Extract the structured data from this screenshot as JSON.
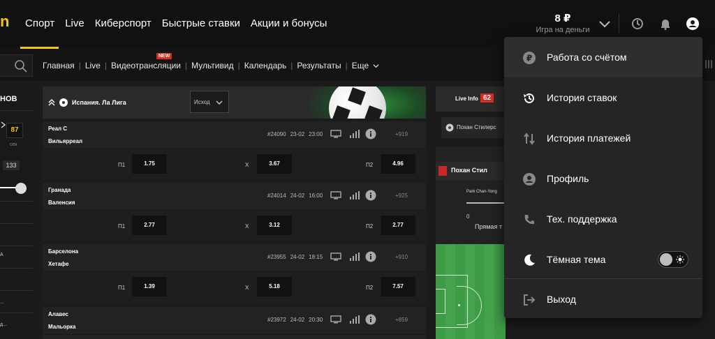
{
  "header": {
    "nav": [
      "Спорт",
      "Live",
      "Киберспорт",
      "Быстрые ставки",
      "Акции и бонусы"
    ],
    "balance_amount": "8 ₽",
    "balance_label": "Игра на деньги"
  },
  "subnav": {
    "items": [
      "Главная",
      "Live",
      "Видеотрансляции",
      "Мультивид",
      "Календарь",
      "Результаты",
      "Еще"
    ],
    "new_badge": "NEW"
  },
  "left_panel": {
    "title": "НОВ",
    "score": "87",
    "score_label": "сек",
    "count": "133",
    "side_a": "А",
    "side_b": "...",
    "side_c": "д..."
  },
  "league": {
    "name": "Испания. Ла Лига",
    "outcome": "Исход"
  },
  "matches": [
    {
      "team1": "Реал С",
      "team2": "Вильярреал",
      "id": "#24090",
      "date": "23-02",
      "time": "23:00",
      "more": "+919",
      "p1_label": "П1",
      "p1": "1.75",
      "x_label": "X",
      "x": "3.67",
      "p2_label": "П2",
      "p2": "4.96"
    },
    {
      "team1": "Гранада",
      "team2": "Валенсия",
      "id": "#24014",
      "date": "24-02",
      "time": "16:00",
      "more": "+925",
      "p1_label": "П1",
      "p1": "2.77",
      "x_label": "X",
      "x": "3.12",
      "p2_label": "П2",
      "p2": "2.77"
    },
    {
      "team1": "Барселона",
      "team2": "Хетафе",
      "id": "#23955",
      "date": "24-02",
      "time": "18:15",
      "more": "+910",
      "p1_label": "П1",
      "p1": "1.39",
      "x_label": "X",
      "x": "5.18",
      "p2_label": "П2",
      "p2": "7.57"
    },
    {
      "team1": "Алавес",
      "team2": "Мальорка",
      "id": "#23972",
      "date": "24-02",
      "time": "20:30",
      "more": "+859"
    }
  ],
  "live_info": {
    "label": "Live Info",
    "count": "62",
    "team": "Похан Стилерс",
    "card_title": "Похан Стил",
    "player": "Park Chan-Yong",
    "zero": "0",
    "broadcast": "Прямая т"
  },
  "menu": {
    "items": [
      "Работа со счётом",
      "История ставок",
      "История платежей",
      "Профиль",
      "Тех. поддержка",
      "Тёмная тема",
      "Выход"
    ],
    "dark_theme_on": false
  },
  "colors": {
    "accent": "#f5c800",
    "badge_red": "#d42d24",
    "menu_bg": "#252525",
    "pitch": "#3e9b46"
  }
}
